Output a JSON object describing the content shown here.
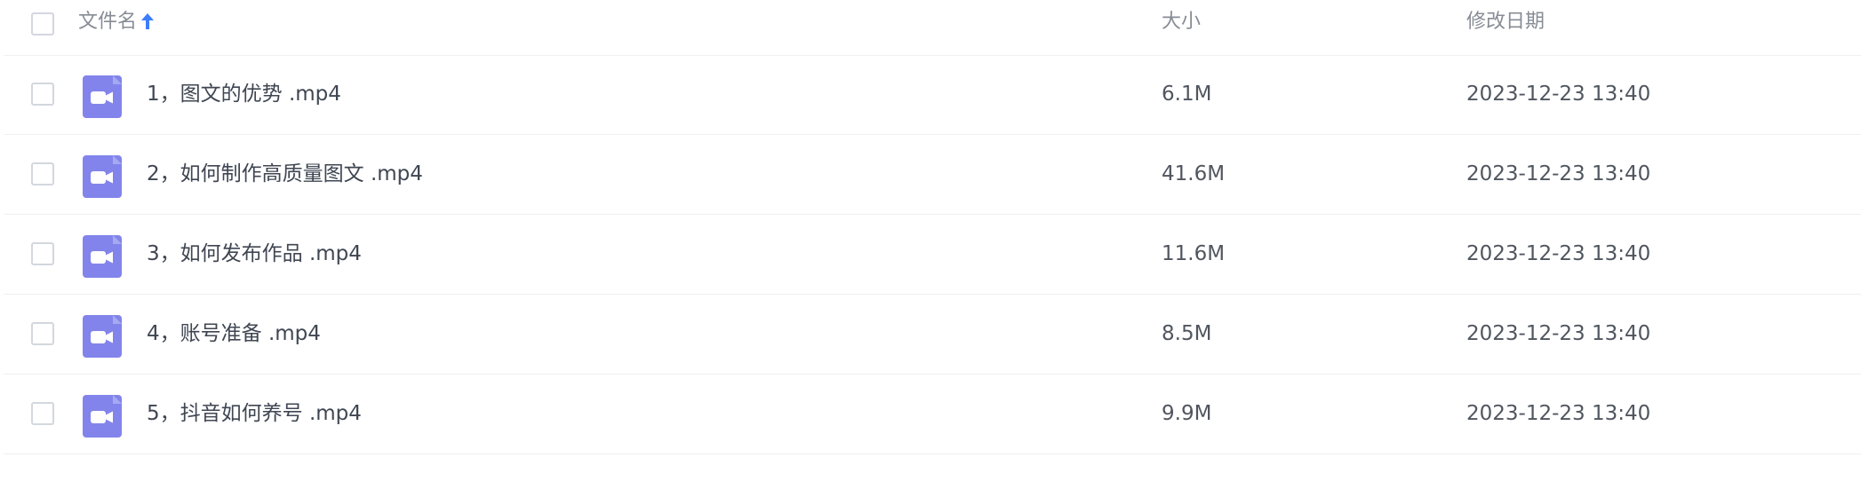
{
  "header": {
    "name_label": "文件名",
    "size_label": "大小",
    "date_label": "修改日期",
    "sort_icon": "arrow-up-icon",
    "sort_color": "#3d7eff"
  },
  "file_icon_color": "#8284eb",
  "files": [
    {
      "name": "1，图文的优势 .mp4",
      "size": "6.1M",
      "modified": "2023-12-23 13:40"
    },
    {
      "name": "2，如何制作高质量图文 .mp4",
      "size": "41.6M",
      "modified": "2023-12-23 13:40"
    },
    {
      "name": "3，如何发布作品 .mp4",
      "size": "11.6M",
      "modified": "2023-12-23 13:40"
    },
    {
      "name": "4，账号准备 .mp4",
      "size": "8.5M",
      "modified": "2023-12-23 13:40"
    },
    {
      "name": "5，抖音如何养号 .mp4",
      "size": "9.9M",
      "modified": "2023-12-23 13:40"
    }
  ]
}
